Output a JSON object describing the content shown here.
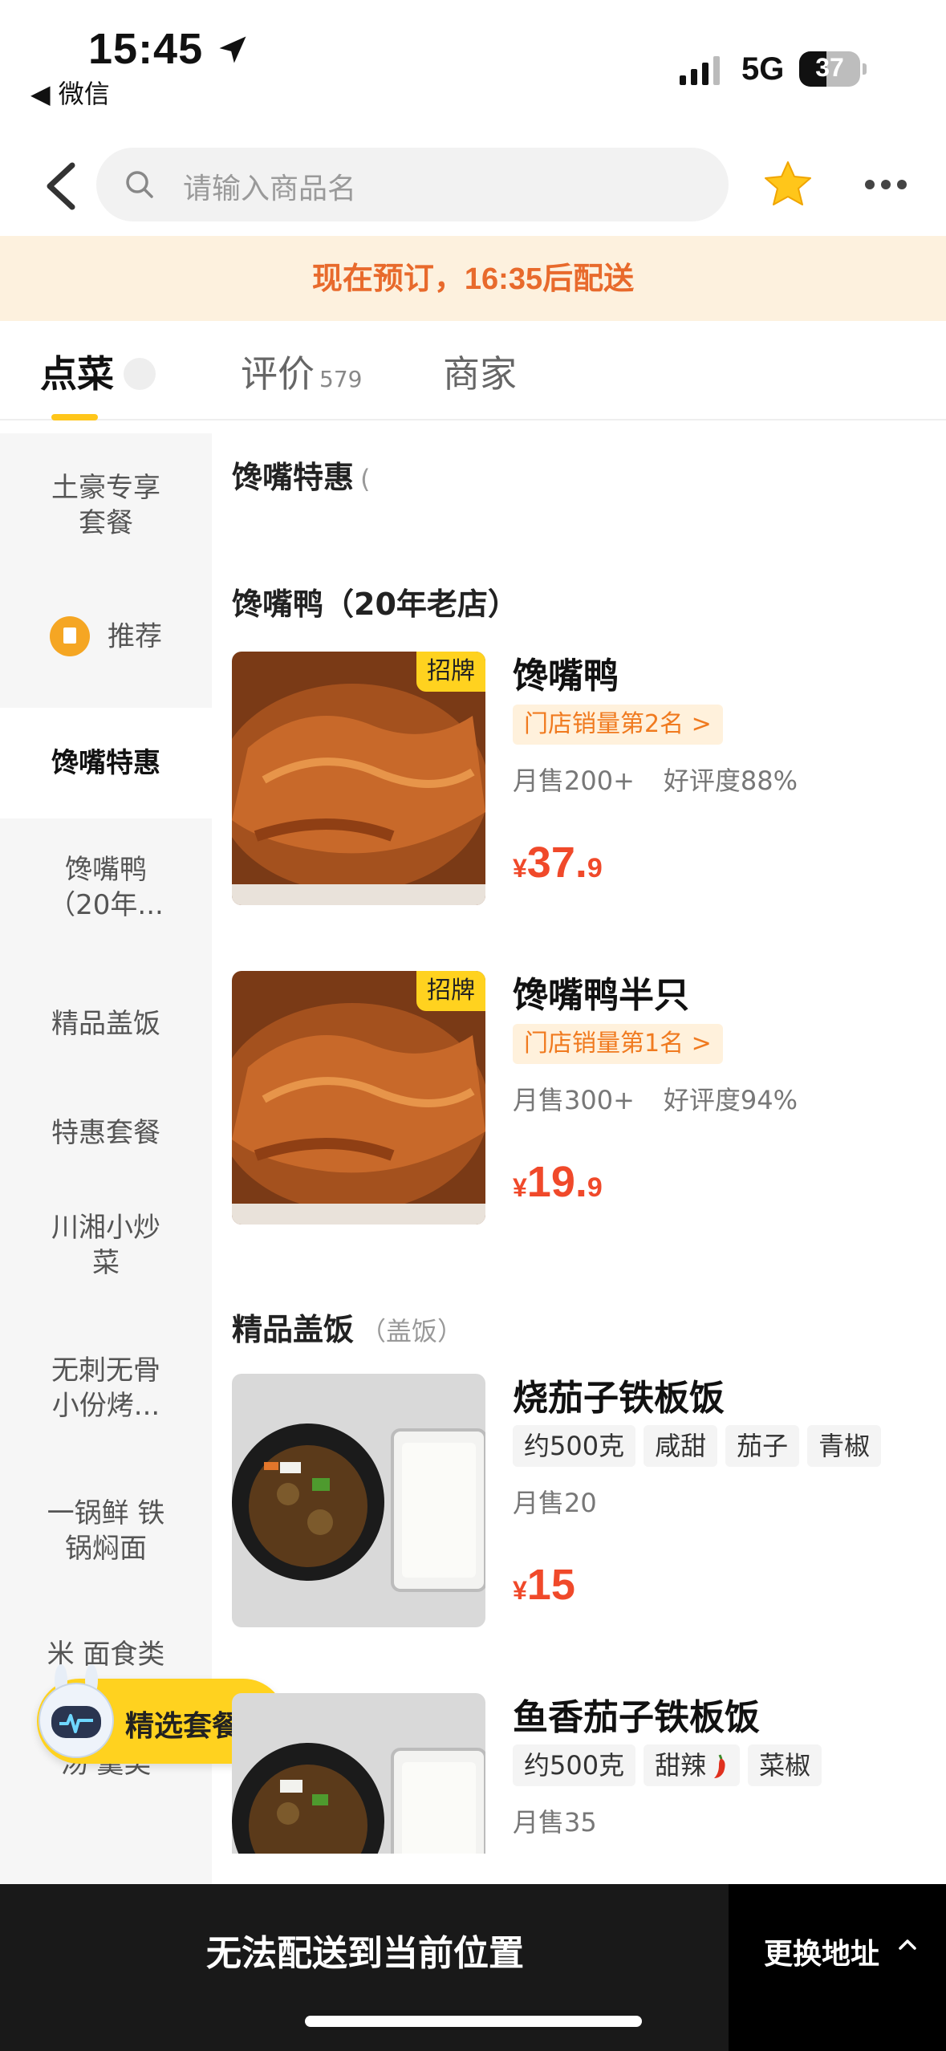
{
  "status_bar": {
    "time": "15:45",
    "back_app": "◀ 微信",
    "network": "5G",
    "battery": "37"
  },
  "header": {
    "search_placeholder": "请输入商品名"
  },
  "banner": {
    "prefix": "现在预订，",
    "time": "16:35",
    "suffix": "后配送"
  },
  "tabs": [
    {
      "label": "点菜",
      "active": true
    },
    {
      "label": "评价",
      "count": "579"
    },
    {
      "label": "商家"
    }
  ],
  "sidebar": {
    "items": [
      {
        "label": "土豪专享套餐"
      },
      {
        "label": "推荐"
      },
      {
        "label": "馋嘴特惠",
        "active": true
      },
      {
        "label": "馋嘴鸭（20年..."
      },
      {
        "label": "精品盖饭"
      },
      {
        "label": "特惠套餐"
      },
      {
        "label": "川湘小炒菜"
      },
      {
        "label": "无刺无骨小份烤..."
      },
      {
        "label": "一锅鲜 铁锅焖面"
      },
      {
        "label": "米 面食类"
      },
      {
        "label": "汤 羹类"
      }
    ],
    "assistant_label": "精选套餐"
  },
  "menu": {
    "sections": [
      {
        "title": "馋嘴特惠",
        "subtitle": "("
      },
      {
        "title": "馋嘴鸭（20年老店）",
        "subtitle": ""
      },
      {
        "title": "精品盖饭",
        "subtitle": "（盖饭）"
      }
    ],
    "items": [
      {
        "name": "馋嘴鸭",
        "badge": "招牌",
        "rank": "门店销量第2名 >",
        "sales": "月售200+",
        "rating": "好评度88%",
        "price_symbol": "¥",
        "price_int": "37.",
        "price_dec": "9"
      },
      {
        "name": "馋嘴鸭半只",
        "badge": "招牌",
        "rank": "门店销量第1名 >",
        "sales": "月售300+",
        "rating": "好评度94%",
        "price_symbol": "¥",
        "price_int": "19.",
        "price_dec": "9"
      },
      {
        "name": "烧茄子铁板饭",
        "tags": [
          "约500克",
          "咸甜",
          "茄子",
          "青椒"
        ],
        "sales": "月售20",
        "price_symbol": "¥",
        "price_int": "15",
        "price_dec": ""
      },
      {
        "name": "鱼香茄子铁板饭",
        "tags": [
          "约500克",
          "甜辣",
          "菜椒"
        ],
        "sales": "月售35"
      }
    ]
  },
  "bottom_bar": {
    "message": "无法配送到当前位置",
    "change_address": "更换地址"
  },
  "colors": {
    "accent": "#ffd21f",
    "price": "#f0492a",
    "banner_text": "#e86a2c",
    "banner_bg": "#fdf1de"
  }
}
